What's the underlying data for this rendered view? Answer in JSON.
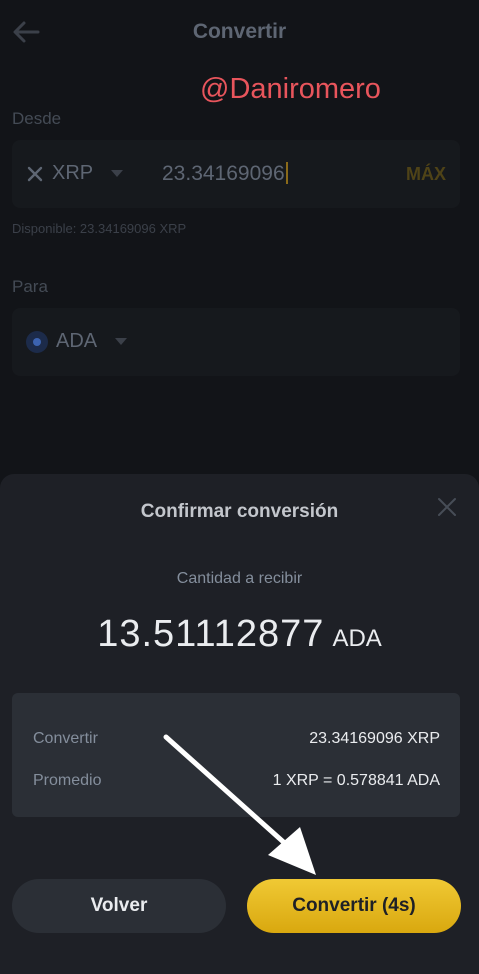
{
  "header": {
    "title": "Convertir"
  },
  "watermark": "@Daniromero",
  "from": {
    "label": "Desde",
    "coin": "XRP",
    "coin_icon": "xrp-icon",
    "amount": "23.34169096",
    "max_label": "MÁX",
    "available": "Disponible: 23.34169096 XRP"
  },
  "to": {
    "label": "Para",
    "coin": "ADA",
    "coin_icon": "cardano-icon"
  },
  "sheet": {
    "title": "Confirmar conversión",
    "receive_label": "Cantidad a recibir",
    "receive_amount": "13.51112877",
    "receive_unit": "ADA",
    "rows": [
      {
        "key": "Convertir",
        "value": "23.34169096 XRP"
      },
      {
        "key": "Promedio",
        "value": "1 XRP = 0.578841 ADA"
      }
    ],
    "back_label": "Volver",
    "convert_label": "Convertir (4s)"
  },
  "colors": {
    "accent": "#f0b90b",
    "sheet_bg": "#1e2026",
    "watermark": "#e8555c"
  }
}
